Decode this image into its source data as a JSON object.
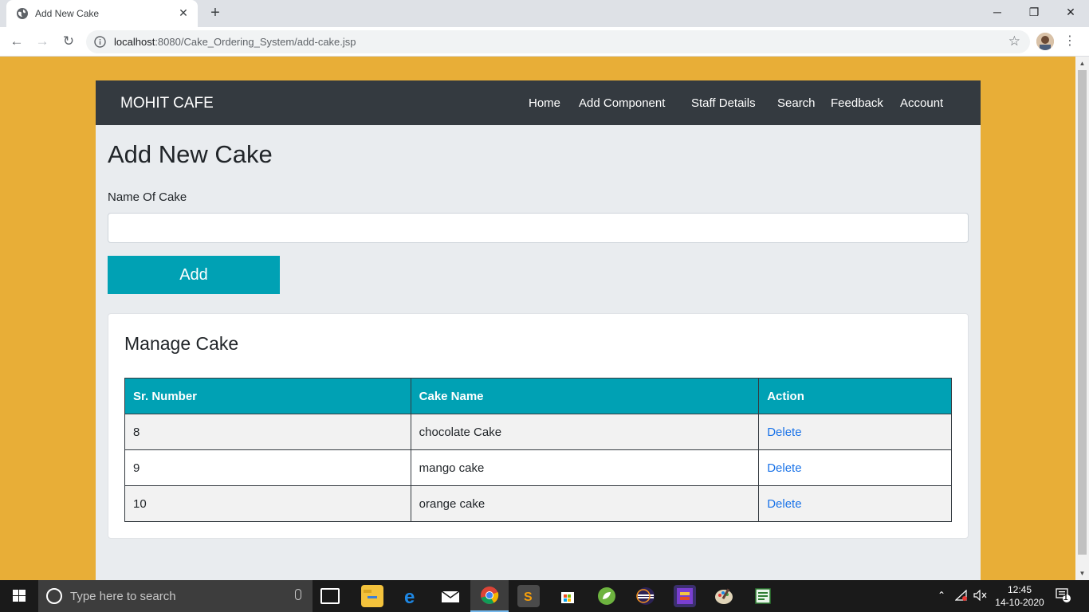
{
  "browser": {
    "tab_title": "Add New Cake",
    "new_tab_label": "+",
    "url_host": "localhost",
    "url_path": ":8080/Cake_Ordering_System/add-cake.jsp"
  },
  "navbar": {
    "brand": "MOHIT CAFE",
    "links": [
      "Home",
      "Add Component",
      "Staff Details",
      "Search",
      "Feedback",
      "Account"
    ]
  },
  "form": {
    "title": "Add New Cake",
    "name_label": "Name Of Cake",
    "name_value": "",
    "add_button": "Add"
  },
  "manage": {
    "title": "Manage Cake",
    "columns": [
      "Sr. Number",
      "Cake Name",
      "Action"
    ],
    "rows": [
      {
        "sr": "8",
        "name": "chocolate Cake",
        "action": "Delete"
      },
      {
        "sr": "9",
        "name": "mango cake",
        "action": "Delete"
      },
      {
        "sr": "10",
        "name": "orange cake",
        "action": "Delete"
      }
    ]
  },
  "taskbar": {
    "search_placeholder": "Type here to search",
    "time": "12:45",
    "date": "14-10-2020",
    "notification_count": "1"
  },
  "colors": {
    "page_background": "#e8ae37",
    "navbar": "#343a40",
    "accent_teal": "#00a1b4",
    "link": "#1a73e8"
  }
}
